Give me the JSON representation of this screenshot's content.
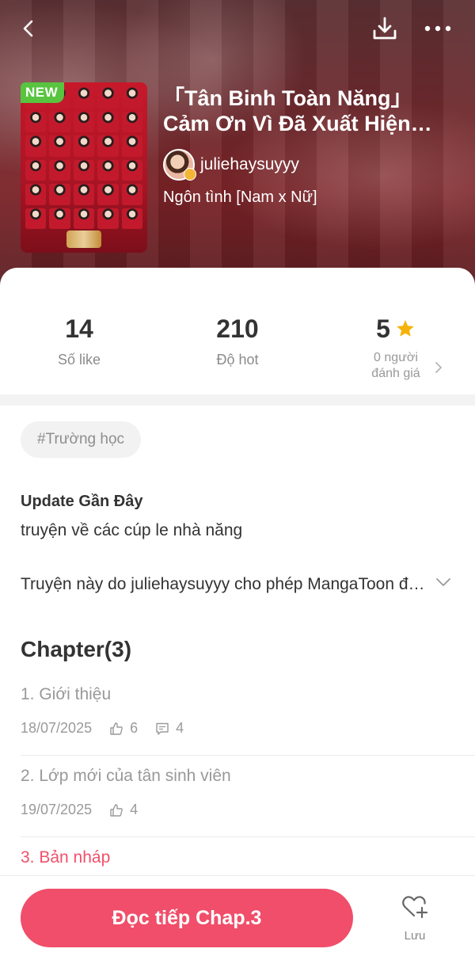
{
  "header": {
    "title": "「Tân Binh Toàn Năng」 Cảm Ơn Vì Đã Xuất Hiện Trong Thanh Xuân Của Chúng Tôi",
    "badge": "NEW",
    "author": "juliehaysuyyy",
    "genre": "Ngôn tình [Nam x Nữ]",
    "icons": [
      "back-arrow-icon",
      "download-icon",
      "more-icon"
    ]
  },
  "stats": {
    "likes": {
      "value": "14",
      "label": "Số like"
    },
    "hot": {
      "value": "210",
      "label": "Độ hot"
    },
    "rating": {
      "value": "5",
      "raters": "0 người",
      "label": "đánh giá"
    }
  },
  "tag": "#Trường học",
  "update": {
    "title": "Update Gần Đây",
    "text": "truyện về các cúp le nhà năng"
  },
  "license": "Truyện này do juliehaysuyyy cho phép MangaToon đăng tải",
  "chapter_heading": "Chapter(3)",
  "chapters": [
    {
      "title": "1. Giới thiệu",
      "date": "18/07/2025",
      "likes": "6",
      "comments": "4"
    },
    {
      "title": "2. Lớp mới của tân sinh viên",
      "date": "19/07/2025",
      "likes": "4"
    },
    {
      "title": "3. Bản nháp"
    }
  ],
  "bottom": {
    "read_label": "Đọc tiếp Chap.3",
    "save_label": "Lưu"
  },
  "colors": {
    "accent": "#f04e6a",
    "badge_green": "#58c43f",
    "star": "#f5b30a"
  }
}
